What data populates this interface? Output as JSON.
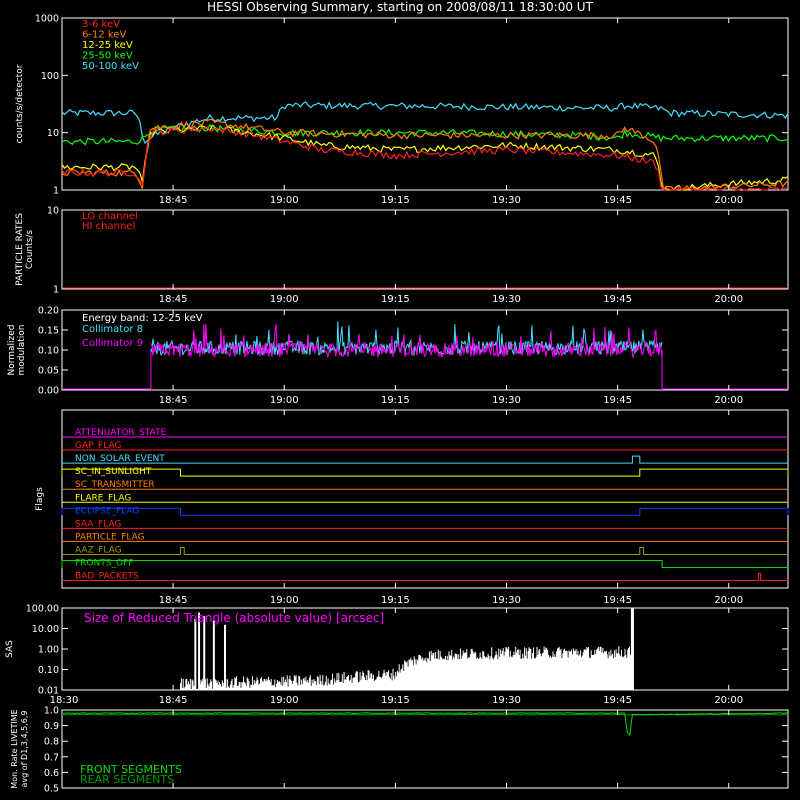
{
  "title": "HESSI Observing Summary, starting on 2008/08/11 18:30:00 UT",
  "time_axis": {
    "start": "18:30",
    "end": "20:08",
    "tick_labels": [
      "18:45",
      "19:00",
      "19:15",
      "19:30",
      "19:45",
      "20:00"
    ],
    "sas_start_label": "18:30"
  },
  "colors": {
    "3-6": "#ff2020",
    "6-12": "#ff7f00",
    "12-25": "#ffff00",
    "25-50": "#00ff00",
    "50-100": "#40e0ff",
    "collimator8": "#40e0ff",
    "collimator9": "#ff00ff",
    "front": "#00dd00",
    "rear": "#009900",
    "sas": "#ffffff"
  },
  "chart_data": [
    {
      "type": "line",
      "name": "count-rates",
      "ylabel": "counts/s/detector",
      "yscale": "log",
      "ylim": [
        1,
        1000
      ],
      "ytick_labels": [
        "1",
        "10",
        "100",
        "1000"
      ],
      "legend": [
        "3-6 keV",
        "6-12 keV",
        "12-25 keV",
        "25-50 keV",
        "50-100 keV"
      ],
      "legend_placement": "top-left",
      "series": [
        {
          "name": "50-100 keV",
          "x": [
            "18:30",
            "18:40",
            "18:41",
            "18:49",
            "18:50",
            "18:59",
            "19:00",
            "19:20",
            "19:40",
            "19:45",
            "19:46",
            "19:51",
            "19:52",
            "20:08"
          ],
          "y": [
            22,
            22,
            7,
            17,
            18,
            18,
            30,
            29,
            27,
            27,
            30,
            26,
            22,
            20
          ]
        },
        {
          "name": "25-50 keV",
          "x": [
            "18:30",
            "18:40",
            "18:41",
            "18:42",
            "18:50",
            "19:00",
            "19:20",
            "19:40",
            "19:45",
            "19:46",
            "19:51",
            "19:52",
            "20:08"
          ],
          "y": [
            7,
            7,
            8,
            11,
            12,
            10,
            10,
            9,
            8,
            10,
            8,
            8,
            8
          ]
        },
        {
          "name": "12-25 keV",
          "x": [
            "18:30",
            "18:40",
            "18:41",
            "18:42",
            "18:50",
            "19:00",
            "19:05",
            "19:15",
            "19:30",
            "19:45",
            "19:50",
            "19:51",
            "20:08"
          ],
          "y": [
            2.5,
            2.5,
            1,
            10,
            12,
            8,
            6,
            5,
            6,
            5,
            4,
            1,
            1.5
          ]
        },
        {
          "name": "6-12 keV",
          "x": [
            "18:30",
            "18:40",
            "18:41",
            "18:42",
            "18:50",
            "19:00",
            "19:15",
            "19:30",
            "19:45",
            "19:46",
            "19:50",
            "19:51",
            "20:08"
          ],
          "y": [
            2,
            2,
            1,
            12,
            15,
            10,
            9,
            9,
            9,
            12,
            7,
            1,
            1.3
          ]
        },
        {
          "name": "3-6 keV",
          "x": [
            "18:30",
            "18:40",
            "18:41",
            "18:42",
            "18:50",
            "19:00",
            "19:05",
            "19:15",
            "19:30",
            "19:45",
            "19:50",
            "19:51",
            "20:08"
          ],
          "y": [
            2,
            2,
            1,
            10,
            12,
            7,
            5,
            4,
            5,
            4,
            3,
            1,
            1
          ]
        }
      ]
    },
    {
      "type": "line",
      "name": "particle-rates",
      "ylabel": "PARTICLE RATES Counts/s",
      "yscale": "log",
      "ylim": [
        1,
        10
      ],
      "ytick_labels": [
        "1",
        "10"
      ],
      "legend": [
        "LO channel",
        "HI channel"
      ],
      "series": [
        {
          "name": "LO channel",
          "x": [
            "18:30",
            "20:08"
          ],
          "y": [
            1,
            1
          ]
        },
        {
          "name": "HI channel",
          "x": [
            "18:30",
            "20:08"
          ],
          "y": [
            1,
            1
          ]
        }
      ]
    },
    {
      "type": "line",
      "name": "modulation",
      "ylabel": "Normalized modulation",
      "ylim": [
        0,
        0.2
      ],
      "ytick_labels": [
        "0.00",
        "0.05",
        "0.10",
        "0.15",
        "0.20"
      ],
      "annotation": "Energy band: 12-25 keV",
      "legend": [
        "Collimator 8",
        "Collimator 9"
      ],
      "active_range": [
        "18:42",
        "19:51"
      ],
      "series": [
        {
          "name": "Collimator 8",
          "x": [
            "18:42",
            "19:51"
          ],
          "y": [
            0.105,
            0.105
          ]
        },
        {
          "name": "Collimator 9",
          "x": [
            "18:42",
            "19:51"
          ],
          "y": [
            0.1,
            0.1
          ]
        }
      ]
    },
    {
      "type": "line",
      "name": "flags",
      "ylabel": "Flags",
      "flags": [
        {
          "label": "ATTENUATOR_STATE",
          "color": "#ff00ff",
          "segments": []
        },
        {
          "label": "GAP_FLAG",
          "color": "#ff2020",
          "segments": []
        },
        {
          "label": "NON_SOLAR_EVENT",
          "color": "#40e0ff",
          "segments": [
            [
              "19:47",
              "19:48"
            ]
          ]
        },
        {
          "label": "SC_IN_SUNLIGHT",
          "color": "#ffff00",
          "segments": [
            [
              "18:30",
              "18:46"
            ],
            [
              "19:48",
              "20:08"
            ]
          ]
        },
        {
          "label": "SC_TRANSMITTER",
          "color": "#ff7f00",
          "segments": []
        },
        {
          "label": "FLARE_FLAG",
          "color": "#ffff00",
          "segments": []
        },
        {
          "label": "ECLIPSE_FLAG",
          "color": "#0040ff",
          "segments": [
            [
              "18:30",
              "18:46"
            ],
            [
              "19:48",
              "20:08"
            ]
          ]
        },
        {
          "label": "SAA_FLAG",
          "color": "#ff2020",
          "segments": []
        },
        {
          "label": "PARTICLE_FLAG",
          "color": "#ff7f00",
          "segments": []
        },
        {
          "label": "AAZ_FLAG",
          "color": "#999900",
          "segments": [
            [
              "18:46",
              "18:46.5"
            ],
            [
              "19:48",
              "19:48.5"
            ]
          ]
        },
        {
          "label": "FRONTS_OFF",
          "color": "#00dd00",
          "segments": [
            [
              "18:30",
              "19:51"
            ]
          ]
        },
        {
          "label": "BAD_PACKETS",
          "color": "#ff2020",
          "segments": [
            [
              "20:04",
              "20:04.3"
            ]
          ]
        }
      ]
    },
    {
      "type": "line",
      "name": "sas",
      "ylabel": "SAS",
      "yscale": "log",
      "ylim": [
        0.01,
        100
      ],
      "ytick_labels": [
        "0.01",
        "0.10",
        "1.00",
        "10.00",
        "100.00"
      ],
      "annotation": "Size of Reduced Triangle (absolute value) [arcsec]",
      "series": [
        {
          "name": "",
          "x": [
            "18:46",
            "18:55",
            "19:05",
            "19:15",
            "19:20",
            "19:30",
            "19:40",
            "19:47"
          ],
          "y": [
            0.01,
            0.012,
            0.015,
            0.03,
            0.25,
            0.32,
            0.35,
            0.35
          ]
        }
      ]
    },
    {
      "type": "line",
      "name": "livetime",
      "ylabel": "Mon. Rate LIVETIME avg of D1,3,4,5,6,9",
      "ylim": [
        0.5,
        1.0
      ],
      "ytick_labels": [
        "0.5",
        "0.6",
        "0.7",
        "0.8",
        "0.9",
        "1.0"
      ],
      "legend": [
        "FRONT SEGMENTS",
        "REAR SEGMENTS"
      ],
      "series": [
        {
          "name": "FRONT SEGMENTS",
          "x": [
            "18:30",
            "19:46",
            "19:46.5",
            "19:47",
            "20:08"
          ],
          "y": [
            0.98,
            0.98,
            0.78,
            0.97,
            0.98
          ]
        },
        {
          "name": "REAR SEGMENTS",
          "x": [
            "18:30",
            "20:08"
          ],
          "y": [
            0.97,
            0.97
          ]
        }
      ]
    }
  ]
}
